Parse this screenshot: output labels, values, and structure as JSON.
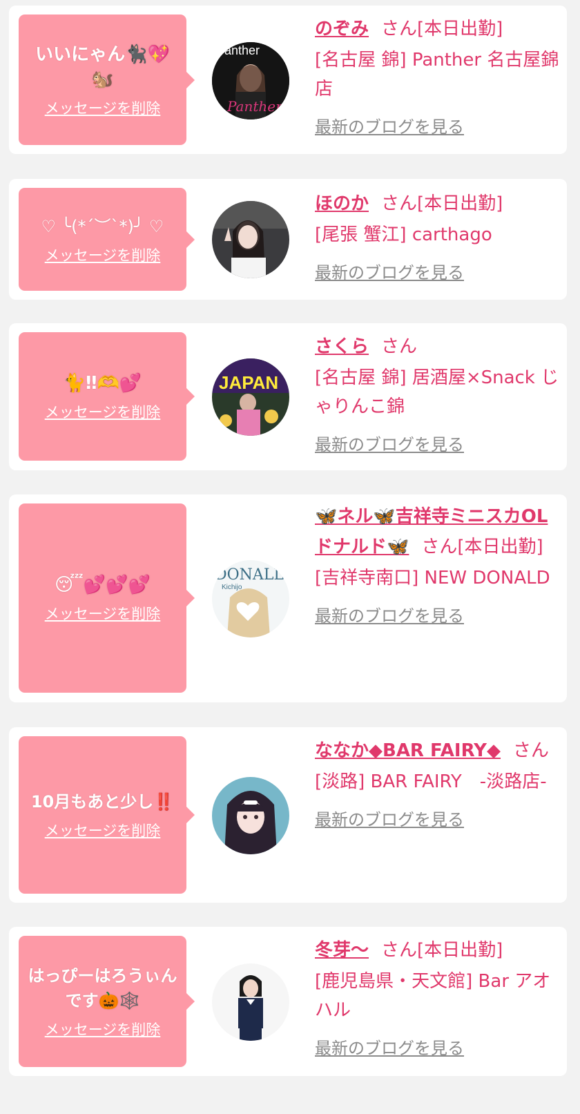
{
  "colors": {
    "accent": "#e0386b",
    "bubble": "#fd99a6",
    "link_gray": "#8b8b8b",
    "background": "#f2f2f2"
  },
  "common": {
    "delete_label": "メッセージを削除",
    "blog_label": "最新のブログを見る"
  },
  "cards": [
    {
      "message": "いいにゃん🐈‍⬛💖🐿️",
      "name": "のぞみ",
      "suffix": "さん[本日出勤]",
      "shop": "[名古屋 錦] Panther 名古屋錦店"
    },
    {
      "message": "♡ ╰(*´︶`*)╯ ♡",
      "name": "ほのか",
      "suffix": "さん[本日出勤]",
      "shop": "[尾張 蟹江] carthago"
    },
    {
      "message": "🐈‼︎🫶💕",
      "name": "さくら",
      "suffix": "さん",
      "shop": "[名古屋 錦] 居酒屋×Snack じゃりんこ錦"
    },
    {
      "message": "😴💕💕💕",
      "name": "🦋ネル🦋吉祥寺ミニスカOLドナルド🦋",
      "suffix": "さん[本日出勤]",
      "shop": "[吉祥寺南口] NEW DONALD"
    },
    {
      "message": "10月もあと少し‼️",
      "name": "ななか◆BAR FAIRY◆",
      "suffix": "さん",
      "shop": "[淡路] BAR FAIRY　-淡路店-"
    },
    {
      "message": "はっぴーはろうぃんです🎃🕸️",
      "name": "冬芽〜",
      "suffix": "さん[本日出勤]",
      "shop": "[鹿児島県・天文館] Bar アオハル"
    }
  ]
}
